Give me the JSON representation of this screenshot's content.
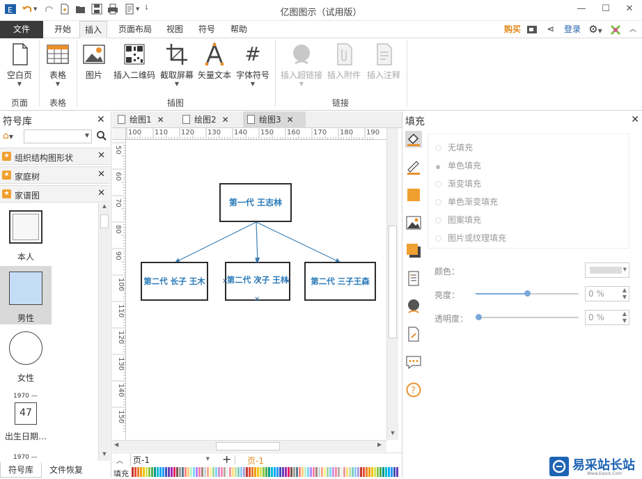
{
  "app": {
    "title": "亿图图示（试用版）"
  },
  "menu": {
    "file": "文件",
    "start": "开始",
    "insert": "插入",
    "page_layout": "页面布局",
    "view": "视图",
    "symbol": "符号",
    "help": "帮助",
    "buy": "购买",
    "login": "登录"
  },
  "ribbon": {
    "blank_page": "空白页",
    "table": "表格",
    "image": "图片",
    "qrcode": "插入二维码",
    "screenshot": "截取屏幕",
    "vector_text": "矢量文本",
    "font_symbol": "字体符号",
    "hyperlink": "插入超链接",
    "attachment": "插入附件",
    "annotation": "插入注释",
    "groups": {
      "page": "页面",
      "table": "表格",
      "illustration": "插图",
      "link": "链接"
    }
  },
  "left_panel": {
    "title": "符号库",
    "libraries": [
      "组织结构图形状",
      "家庭树",
      "家谱图"
    ],
    "shapes": {
      "self": "本人",
      "male": "男性",
      "female": "女性",
      "birth_year": "1970 —",
      "birth_number": "47",
      "birth_label": "出生日期…",
      "second_year": "1970 —"
    },
    "bottom_tabs": {
      "library": "符号库",
      "recovery": "文件恢复"
    }
  },
  "doc_tabs": [
    "绘图1",
    "绘图2",
    "绘图3"
  ],
  "ruler": {
    "h": [
      "100",
      "110",
      "120",
      "130",
      "140",
      "150",
      "160",
      "170",
      "180",
      "190"
    ],
    "v": [
      "50",
      "60",
      "70",
      "80",
      "90",
      "100",
      "110",
      "120",
      "130",
      "140",
      "150"
    ]
  },
  "diagram": {
    "root": "第一代  王志林",
    "child1": "第二代 长子 王木",
    "child2": "第二代 次子 王林",
    "child3": "第二代 三子王森"
  },
  "page_bar": {
    "page_select": "页-1",
    "page_tab": "页-1",
    "fill_label": "填充"
  },
  "right_panel": {
    "title": "填充",
    "options": [
      "无填充",
      "单色填充",
      "渐变填充",
      "单色渐变填充",
      "图案填充",
      "图片或纹理填充"
    ],
    "selected": "单色填充",
    "color_label": "颜色：",
    "brightness_label": "亮度：",
    "brightness_value": "0 %",
    "brightness_level": 0.5,
    "transparency_label": "透明度：",
    "transparency_value": "0 %",
    "transparency_level": 0.0
  },
  "watermark": {
    "text": "易采站长站",
    "sub": "Www.Easck.Com"
  },
  "colors": {
    "accent": "#2b7bb9",
    "orange": "#f0a030",
    "selected_bg": "#c5dcf5"
  }
}
